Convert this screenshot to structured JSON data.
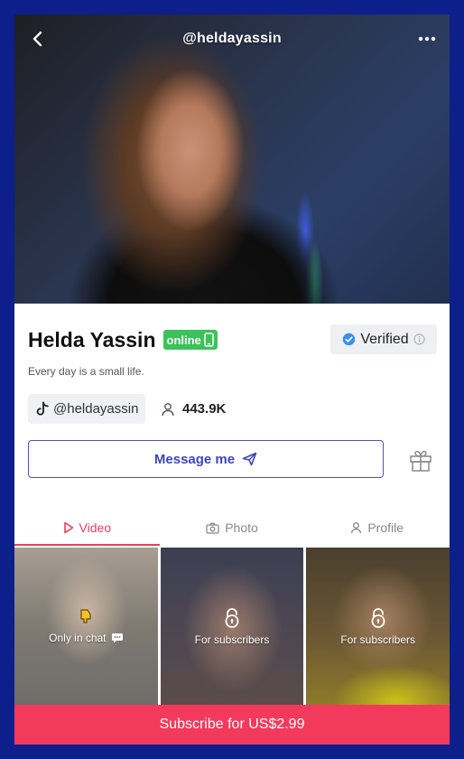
{
  "header": {
    "title": "@heldayassin",
    "back_icon": "chevron-left-icon",
    "more_icon": "more-dots-icon"
  },
  "profile": {
    "name": "Helda Yassin",
    "online_label": "online",
    "verified_label": "Verified",
    "bio": "Every day is a small life.",
    "tiktok_handle": "@heldayassin",
    "followers": "443.9K"
  },
  "actions": {
    "message_label": "Message me"
  },
  "tabs": [
    {
      "label": "Video",
      "icon": "play-icon",
      "active": true
    },
    {
      "label": "Photo",
      "icon": "camera-icon",
      "active": false
    },
    {
      "label": "Profile",
      "icon": "person-icon",
      "active": false
    }
  ],
  "media": [
    {
      "label": "Only in chat",
      "icon": "pointing-hand-icon"
    },
    {
      "label": "For subscribers",
      "icon": "lock-icon"
    },
    {
      "label": "For subscribers",
      "icon": "lock-icon"
    }
  ],
  "subscribe": {
    "label": "Subscribe for US$2.99"
  },
  "colors": {
    "page_background": "#0c1f8a",
    "accent": "#ef3d5a",
    "online_green": "#3cc25a",
    "message_blue": "#3d44c2",
    "subscribe_bar": "#f33a5c"
  }
}
